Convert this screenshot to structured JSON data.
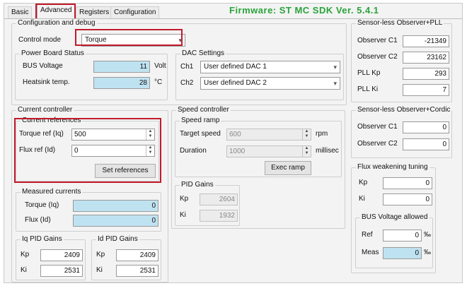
{
  "tabs": [
    "Basic",
    "Advanced",
    "Registers",
    "Configuration"
  ],
  "firmware": "Firmware: ST MC SDK Ver. 5.4.1",
  "config": {
    "title": "Configuration and debug",
    "control_mode_label": "Control mode",
    "control_mode_value": "Torque"
  },
  "power_board": {
    "title": "Power Board Status",
    "bus_voltage_label": "BUS Voltage",
    "bus_voltage_value": "11",
    "bus_voltage_unit": "Volt",
    "heatsink_label": "Heatsink temp.",
    "heatsink_value": "28",
    "heatsink_unit": "°C"
  },
  "dac": {
    "title": "DAC Settings",
    "ch1_label": "Ch1",
    "ch1_value": "User defined DAC 1",
    "ch2_label": "Ch2",
    "ch2_value": "User defined DAC 2"
  },
  "observer_pll": {
    "title": "Sensor-less Observer+PLL",
    "c1_label": "Observer C1",
    "c1_value": "-21349",
    "c2_label": "Observer C2",
    "c2_value": "23162",
    "kp_label": "PLL Kp",
    "kp_value": "293",
    "ki_label": "PLL Ki",
    "ki_value": "7"
  },
  "current_controller": {
    "title": "Current controller",
    "refs_title": "Current references",
    "torque_ref_label": "Torque ref (Iq)",
    "torque_ref_value": "500",
    "flux_ref_label": "Flux ref (Id)",
    "flux_ref_value": "0",
    "set_button": "Set references",
    "measured_title": "Measured currents",
    "torque_label": "Torque (Iq)",
    "torque_value": "0",
    "flux_label": "Flux (Id)",
    "flux_value": "0",
    "iq_pid_title": "Iq PID Gains",
    "iq_kp_label": "Kp",
    "iq_kp_value": "2409",
    "iq_ki_label": "Ki",
    "iq_ki_value": "2531",
    "id_pid_title": "Id PID Gains",
    "id_kp_label": "Kp",
    "id_kp_value": "2409",
    "id_ki_label": "Ki",
    "id_ki_value": "2531"
  },
  "speed_controller": {
    "title": "Speed controller",
    "ramp_title": "Speed ramp",
    "target_label": "Target speed",
    "target_value": "600",
    "target_unit": "rpm",
    "duration_label": "Duration",
    "duration_value": "1000",
    "duration_unit": "millisec",
    "exec_button": "Exec ramp",
    "pid_title": "PID Gains",
    "kp_label": "Kp",
    "kp_value": "2604",
    "ki_label": "Ki",
    "ki_value": "1932"
  },
  "observer_cordic": {
    "title": "Sensor-less Observer+Cordic",
    "c1_label": "Observer C1",
    "c1_value": "0",
    "c2_label": "Observer C2",
    "c2_value": "0"
  },
  "flux_weakening": {
    "title": "Flux weakening tuning",
    "kp_label": "Kp",
    "kp_value": "0",
    "ki_label": "Ki",
    "ki_value": "0",
    "bus_title": "BUS Voltage allowed",
    "ref_label": "Ref",
    "ref_value": "0",
    "ref_unit": "‰",
    "meas_label": "Meas",
    "meas_value": "0",
    "meas_unit": "‰"
  }
}
